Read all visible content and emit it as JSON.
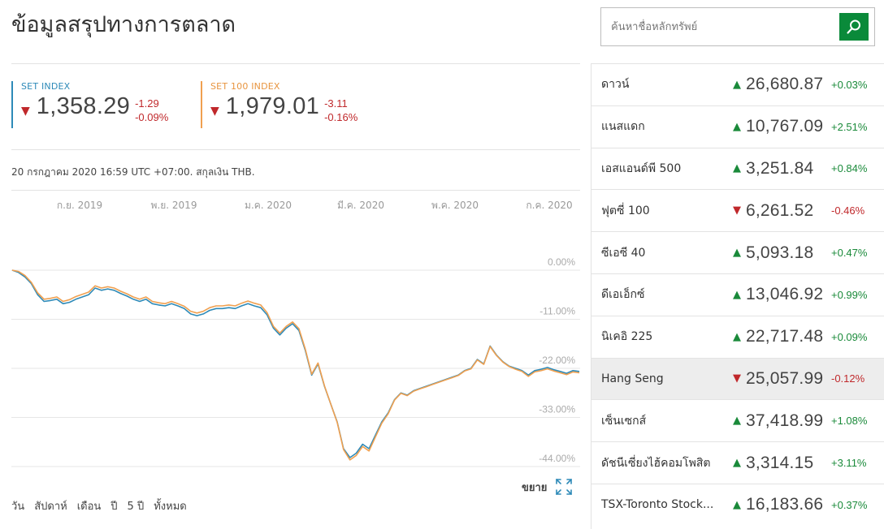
{
  "page": {
    "title": "ข้อมูลสรุปทางการตลาด",
    "meta": "20 กรกฎาคม 2020 16:59 UTC +07:00. สกุลเงิน THB."
  },
  "indices": [
    {
      "label": "SET INDEX",
      "value": "1,358.29",
      "change": "-1.29",
      "change_pct": "-0.09%",
      "direction": "down",
      "color": "#2e8ab8"
    },
    {
      "label": "SET 100 INDEX",
      "value": "1,979.01",
      "change": "-3.11",
      "change_pct": "-0.16%",
      "direction": "down",
      "color": "#f0a050"
    }
  ],
  "chart_data": {
    "type": "line",
    "x_ticks": [
      "ก.ย. 2019",
      "พ.ย. 2019",
      "ม.ค. 2020",
      "มี.ค. 2020",
      "พ.ค. 2020",
      "ก.ค. 2020"
    ],
    "y_ticks": [
      "0.00%",
      "-11.00%",
      "-22.00%",
      "-33.00%",
      "-44.00%"
    ],
    "ylim": [
      -44,
      0
    ],
    "grid": true,
    "series": [
      {
        "name": "SET INDEX",
        "color": "#2e8ab8",
        "values": [
          0,
          -0.5,
          -1.5,
          -3,
          -5.5,
          -7,
          -6.8,
          -6.5,
          -7.5,
          -7.2,
          -6.5,
          -6,
          -5.5,
          -4,
          -4.5,
          -4.2,
          -4.5,
          -5.2,
          -5.8,
          -6.5,
          -7,
          -6.5,
          -7.5,
          -7.8,
          -8,
          -7.5,
          -8,
          -8.6,
          -9.8,
          -10.2,
          -9.8,
          -9,
          -8.6,
          -8.6,
          -8.4,
          -8.6,
          -8,
          -7.5,
          -8,
          -8.4,
          -10,
          -13,
          -14.5,
          -13,
          -12,
          -13.5,
          -18,
          -23.5,
          -21,
          -26,
          -30,
          -34,
          -40,
          -42,
          -41,
          -39,
          -40,
          -37,
          -34,
          -32,
          -29,
          -27.5,
          -28,
          -27,
          -26.5,
          -26,
          -25.5,
          -25,
          -24.5,
          -24,
          -23.5,
          -22.5,
          -22,
          -20,
          -21,
          -17,
          -19,
          -20.5,
          -21.5,
          -22,
          -22.5,
          -23.5,
          -22.5,
          -22.2,
          -21.8,
          -22.3,
          -22.7,
          -23.1,
          -22.5,
          -22.7
        ]
      },
      {
        "name": "SET 100 INDEX",
        "color": "#f0a050",
        "values": [
          0,
          -0.3,
          -1.2,
          -2.7,
          -5.1,
          -6.5,
          -6.3,
          -6,
          -7,
          -6.6,
          -5.9,
          -5.4,
          -4.9,
          -3.5,
          -4,
          -3.7,
          -4,
          -4.7,
          -5.3,
          -6,
          -6.5,
          -6,
          -7,
          -7.3,
          -7.5,
          -7,
          -7.5,
          -8.1,
          -9.2,
          -9.6,
          -9.2,
          -8.4,
          -8,
          -8,
          -7.8,
          -8,
          -7.4,
          -6.9,
          -7.4,
          -7.8,
          -9.5,
          -12.6,
          -14.1,
          -12.6,
          -11.6,
          -13.1,
          -17.7,
          -23.3,
          -20.8,
          -25.9,
          -30,
          -34.1,
          -40.2,
          -42.5,
          -41.5,
          -39.5,
          -40.5,
          -37.4,
          -34.3,
          -32.2,
          -29.1,
          -27.6,
          -28.1,
          -27.1,
          -26.6,
          -26.1,
          -25.6,
          -25.1,
          -24.6,
          -24.1,
          -23.6,
          -22.6,
          -22.1,
          -20.1,
          -21.1,
          -17.1,
          -19.1,
          -20.6,
          -21.6,
          -22.2,
          -22.7,
          -23.8,
          -22.8,
          -22.5,
          -22.1,
          -22.6,
          -23,
          -23.4,
          -22.8,
          -23
        ]
      }
    ]
  },
  "chart_controls": {
    "expand_label": "ขยาย",
    "expand_icon": "expand-arrows-icon",
    "ranges": [
      "วัน",
      "สัปดาห์",
      "เดือน",
      "ปี",
      "5 ปี",
      "ทั้งหมด"
    ]
  },
  "search": {
    "placeholder": "ค้นหาชื่อหลักทรัพย์",
    "icon": "search-icon",
    "button_color": "#0a8a3a"
  },
  "markets": [
    {
      "name": "ดาวน์",
      "value": "26,680.87",
      "change_pct": "+0.03%",
      "direction": "up"
    },
    {
      "name": "แนสแดก",
      "value": "10,767.09",
      "change_pct": "+2.51%",
      "direction": "up"
    },
    {
      "name": "เอสแอนด์พี 500",
      "value": "3,251.84",
      "change_pct": "+0.84%",
      "direction": "up"
    },
    {
      "name": "ฟุตซี่ 100",
      "value": "6,261.52",
      "change_pct": "-0.46%",
      "direction": "down"
    },
    {
      "name": "ซีเอซี 40",
      "value": "5,093.18",
      "change_pct": "+0.47%",
      "direction": "up"
    },
    {
      "name": "ดีเอเอ็กซ์",
      "value": "13,046.92",
      "change_pct": "+0.99%",
      "direction": "up"
    },
    {
      "name": "นิเคอิ 225",
      "value": "22,717.48",
      "change_pct": "+0.09%",
      "direction": "up"
    },
    {
      "name": "Hang Seng",
      "value": "25,057.99",
      "change_pct": "-0.12%",
      "direction": "down",
      "highlighted": true
    },
    {
      "name": "เซ็นเซกส์",
      "value": "37,418.99",
      "change_pct": "+1.08%",
      "direction": "up"
    },
    {
      "name": "ดัชนีเซี่ยงไฮ้คอมโพสิต",
      "value": "3,314.15",
      "change_pct": "+3.11%",
      "direction": "up"
    },
    {
      "name": "TSX-Toronto Stock...",
      "value": "16,183.66",
      "change_pct": "+0.37%",
      "direction": "up"
    }
  ],
  "colors": {
    "up": "#1a8a3a",
    "down": "#c0282b"
  }
}
